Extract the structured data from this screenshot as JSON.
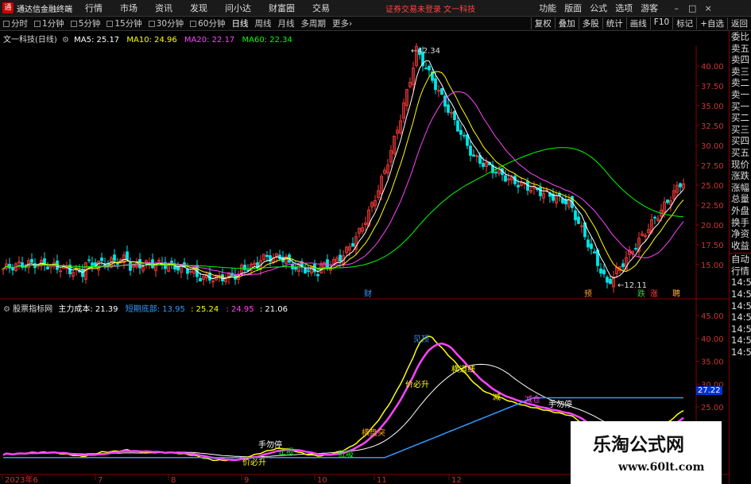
{
  "titlebar": {
    "logo": "通",
    "app": "通达信金融终端",
    "menus": [
      "行情",
      "市场",
      "资讯",
      "发现",
      "问小达",
      "财富圈",
      "交易"
    ],
    "notice": "证券交易未登录 文一科技",
    "right": [
      "功能",
      "版面",
      "公式",
      "选项",
      "游客"
    ]
  },
  "toolbar": {
    "periods": [
      "分时",
      "1分钟",
      "5分钟",
      "15分钟",
      "30分钟",
      "60分钟",
      "日线",
      "周线",
      "月线",
      "多周期",
      "更多"
    ],
    "active": "日线",
    "right": [
      "复权",
      "叠加",
      "多股",
      "统计",
      "画线",
      "F10",
      "标记",
      "+自选",
      "返回"
    ]
  },
  "main": {
    "title": "文一科技(日线)",
    "ma": [
      {
        "label": "MA5: 25.17",
        "color": "#ffffff"
      },
      {
        "label": "MA10: 24.96",
        "color": "#ffff00"
      },
      {
        "label": "MA20: 22.17",
        "color": "#ff44ff"
      },
      {
        "label": "MA60: 22.34",
        "color": "#00ff00"
      }
    ],
    "high_label": "42.34",
    "low_label": "12.11",
    "events": [
      {
        "text": "财",
        "color": "#3399ff"
      },
      {
        "text": "预",
        "color": "#ff9933"
      },
      {
        "text": "跌",
        "color": "#33cc33"
      },
      {
        "text": "涨",
        "color": "#ff4444"
      },
      {
        "text": "聘",
        "color": "#ffaa33"
      }
    ]
  },
  "axis_main": [
    "40.00",
    "37.50",
    "35.00",
    "32.50",
    "30.00",
    "27.50",
    "25.00",
    "22.50",
    "20.00",
    "17.50",
    "15.00"
  ],
  "sub": {
    "title": "股票指标网",
    "values": [
      {
        "label": "主力成本: 21.39",
        "color": "#ffffff"
      },
      {
        "label": "短期底部: 13.95",
        "color": "#3399ff"
      },
      {
        "label": ": 25.24",
        "color": "#ffff00"
      },
      {
        "label": ": 24.95",
        "color": "#ff44ff"
      },
      {
        "label": ": 21.06",
        "color": "#ffffff"
      }
    ],
    "annotations": [
      {
        "text": "手勿停",
        "color": "#ffffff"
      },
      {
        "text": "手勿停",
        "color": "#ffffff"
      },
      {
        "text": "低吸",
        "color": "#00ff00"
      },
      {
        "text": "价必升",
        "color": "#ffff00"
      },
      {
        "text": "价必升",
        "color": "#ffff00"
      },
      {
        "text": "横道线",
        "color": "#ffff00"
      },
      {
        "text": "横盘突",
        "color": "#ffaa00"
      },
      {
        "text": "减",
        "color": "#ffff00"
      },
      {
        "text": "减仓",
        "color": "#ff44ff"
      },
      {
        "text": "见顶",
        "color": "#3399ff"
      },
      {
        "text": "止损",
        "color": "#00ff00"
      }
    ],
    "price_tag": "27.22"
  },
  "axis_sub": [
    "45.00",
    "40.00",
    "35.00",
    "30.00",
    "25.00"
  ],
  "dates": [
    "2023年6",
    "7",
    "8",
    "9",
    "10",
    "11",
    "12",
    "1"
  ],
  "right_panel": [
    "委比",
    "卖五",
    "卖四",
    "卖三",
    "卖二",
    "卖一",
    "买一",
    "买二",
    "买三",
    "买四",
    "买五",
    "现价",
    "涨跌",
    "涨幅",
    "总量",
    "外盘",
    "换手",
    "净资",
    "收益",
    "自动",
    "行情",
    "14:5",
    "14:5",
    "14:5",
    "14:5",
    "14:5",
    "14:5",
    "14:5"
  ],
  "watermark": {
    "title": "乐淘公式网",
    "url": "www.60lt.com"
  }
}
